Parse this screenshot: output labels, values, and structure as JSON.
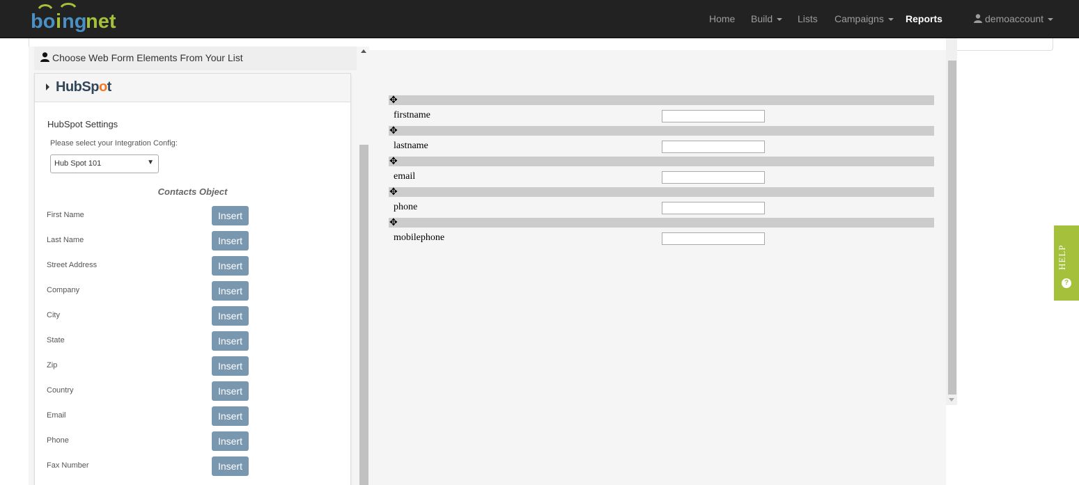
{
  "navbar": {
    "logo_text": "boingnet",
    "items": [
      {
        "label": "Home",
        "has_caret": false,
        "active": false
      },
      {
        "label": "Build",
        "has_caret": true,
        "active": false
      },
      {
        "label": "Lists",
        "has_caret": false,
        "active": false
      },
      {
        "label": "Campaigns",
        "has_caret": true,
        "active": false
      },
      {
        "label": "Reports",
        "has_caret": false,
        "active": true
      }
    ],
    "user": "demoaccount"
  },
  "left_panel": {
    "header": "Choose Web Form Elements From Your List",
    "integration": {
      "logo_text_a": "HubSp",
      "logo_text_o": "o",
      "logo_text_b": "t",
      "settings_title": "HubSpot Settings",
      "config_label": "Please select your Integration Config:",
      "config_selected": "Hub Spot 101",
      "object_title": "Contacts Object",
      "insert_label": "Insert",
      "fields": [
        "First Name",
        "Last Name",
        "Street Address",
        "Company",
        "City",
        "State",
        "Zip",
        "Country",
        "Email",
        "Phone",
        "Fax Number"
      ]
    }
  },
  "form_preview": {
    "fields": [
      "firstname",
      "lastname",
      "email",
      "phone",
      "mobilephone"
    ]
  },
  "help_tab": {
    "label": "HELP",
    "icon": "?"
  },
  "colors": {
    "navbar_bg": "#222222",
    "insert_button": "#7a97b0",
    "help_tab": "#a5c03a",
    "logo_green": "#a5c03a",
    "logo_blue": "#4a90c4"
  }
}
